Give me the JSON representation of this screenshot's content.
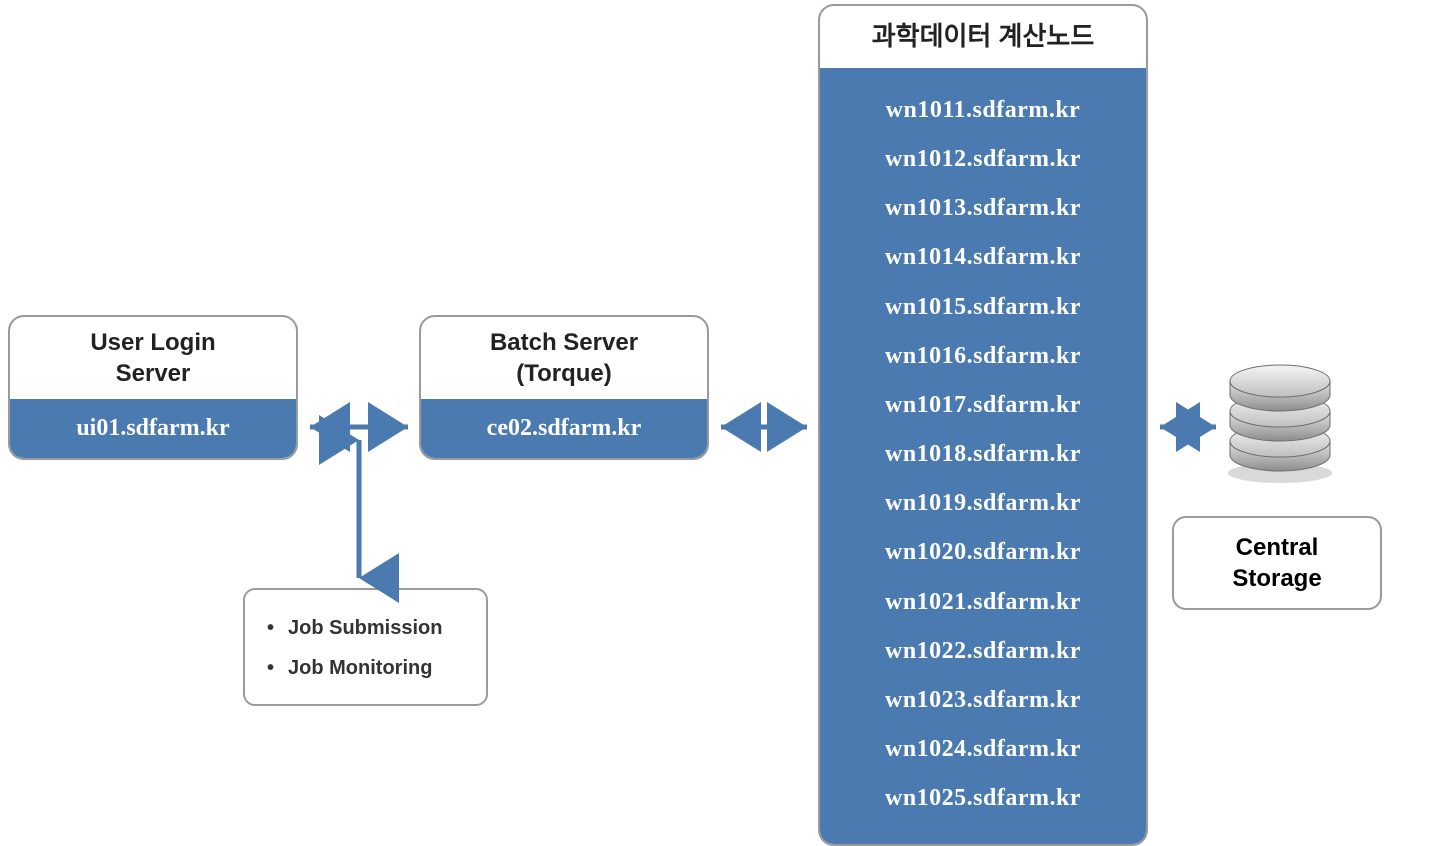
{
  "login": {
    "title_line1": "User Login",
    "title_line2": "Server",
    "host": "ui01.sdfarm.kr"
  },
  "batch": {
    "title_line1": "Batch Server",
    "title_line2": "(Torque)",
    "host": "ce02.sdfarm.kr"
  },
  "compute": {
    "title": "과학데이터 계산노드",
    "nodes": [
      "wn1011.sdfarm.kr",
      "wn1012.sdfarm.kr",
      "wn1013.sdfarm.kr",
      "wn1014.sdfarm.kr",
      "wn1015.sdfarm.kr",
      "wn1016.sdfarm.kr",
      "wn1017.sdfarm.kr",
      "wn1018.sdfarm.kr",
      "wn1019.sdfarm.kr",
      "wn1020.sdfarm.kr",
      "wn1021.sdfarm.kr",
      "wn1022.sdfarm.kr",
      "wn1023.sdfarm.kr",
      "wn1024.sdfarm.kr",
      "wn1025.sdfarm.kr"
    ]
  },
  "annotation": {
    "item1": "Job Submission",
    "item2": "Job Monitoring"
  },
  "storage": {
    "line1": "Central",
    "line2": "Storage"
  }
}
